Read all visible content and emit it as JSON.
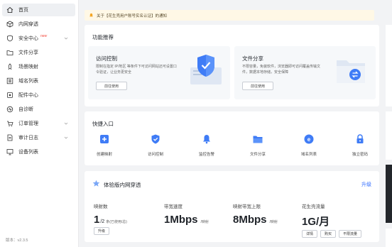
{
  "sidebar": {
    "items": [
      {
        "label": "首页",
        "icon": "home-icon",
        "active": true
      },
      {
        "label": "内网穿透",
        "icon": "cube-icon"
      },
      {
        "label": "安全中心",
        "icon": "shield-icon",
        "badge": "new",
        "expandable": true
      },
      {
        "label": "文件分享",
        "icon": "folder-icon"
      },
      {
        "label": "场景映射",
        "icon": "rocket-icon"
      },
      {
        "label": "域名列表",
        "icon": "list-icon"
      },
      {
        "label": "配件中心",
        "icon": "device-icon"
      },
      {
        "label": "自诊断",
        "icon": "diagnose-icon"
      },
      {
        "label": "订单管理",
        "icon": "order-icon",
        "expandable": true
      },
      {
        "label": "审计日志",
        "icon": "log-icon",
        "expandable": true
      },
      {
        "label": "设备列表",
        "icon": "monitor-icon"
      }
    ],
    "version": "版本：v2.3.5"
  },
  "notice": {
    "text": "关于【花生壳用户账号实名认证】的通知"
  },
  "recommend": {
    "title": "功能推荐",
    "cards": [
      {
        "title": "访问控制",
        "desc": "限制在指定 IP/地区 等条件下可访问网站还可设置口令验证，让业务更安全",
        "button": "前往使用"
      },
      {
        "title": "文件分享",
        "desc": "不限容量，免装软件，浏览器即可访问覆盖传输文件，数据本地存储，安全保障",
        "button": "前往使用"
      }
    ]
  },
  "quick": {
    "title": "快捷入口",
    "items": [
      {
        "label": "创建映射",
        "icon": "plus-icon"
      },
      {
        "label": "访问控制",
        "icon": "shield-check-icon"
      },
      {
        "label": "监控告警",
        "icon": "bell-icon"
      },
      {
        "label": "文件分享",
        "icon": "folder-icon"
      },
      {
        "label": "域名列表",
        "icon": "domain-icon"
      },
      {
        "label": "独立密码",
        "icon": "lock-icon"
      }
    ]
  },
  "plan": {
    "title": "体验版内网穿透",
    "upgrade": "升级",
    "stats": {
      "mappings": {
        "label": "映射数",
        "value": "1",
        "unit": "/2",
        "note": "条(已使用/总)",
        "button": "升级"
      },
      "bandwidth": {
        "label": "带宽速度",
        "value": "1Mbps",
        "unit": "/映射"
      },
      "peak": {
        "label": "映射带宽上限",
        "value": "8Mbps",
        "unit": "/映射"
      },
      "traffic": {
        "label": "花生壳流量",
        "value": "1G/月",
        "buttons": [
          "详情",
          "购买",
          "不限流量"
        ]
      }
    }
  },
  "colors": {
    "accent": "#2f6bff",
    "notice_bg": "#fff8e6",
    "new_badge": "#f24b3e"
  }
}
